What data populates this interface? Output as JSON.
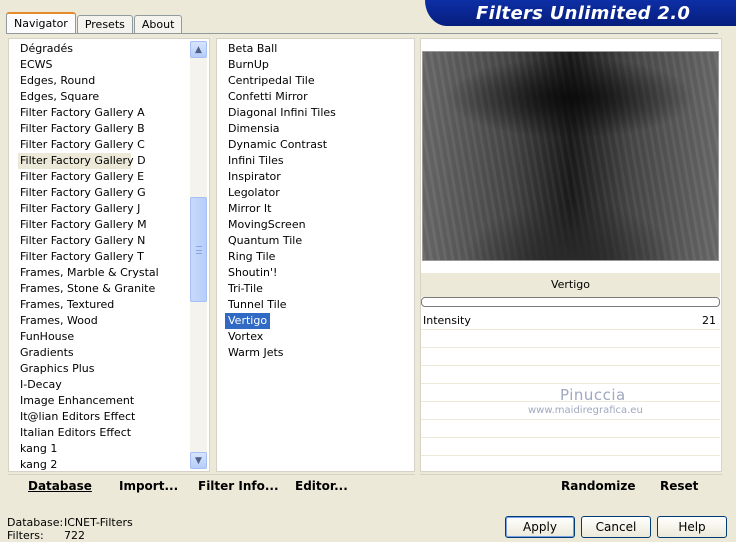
{
  "tabs": [
    "Navigator",
    "Presets",
    "About"
  ],
  "title": "Filters Unlimited 2.0",
  "categories": [
    "Dégradés",
    "ECWS",
    "Edges, Round",
    "Edges, Square",
    "Filter Factory Gallery A",
    "Filter Factory Gallery B",
    "Filter Factory Gallery C",
    "Filter Factory Gallery D",
    "Filter Factory Gallery E",
    "Filter Factory Gallery G",
    "Filter Factory Gallery J",
    "Filter Factory Gallery M",
    "Filter Factory Gallery N",
    "Filter Factory Gallery T",
    "Frames, Marble & Crystal",
    "Frames, Stone & Granite",
    "Frames, Textured",
    "Frames, Wood",
    "FunHouse",
    "Gradients",
    "Graphics Plus",
    "I-Decay",
    "Image Enhancement",
    "It@lian Editors Effect",
    "Italian Editors Effect",
    "kang 1",
    "kang 2"
  ],
  "selected_category": "Filter Factory Gallery D",
  "filters": [
    "Beta Ball",
    "BurnUp",
    "Centripedal Tile",
    "Confetti Mirror",
    "Diagonal Infini Tiles",
    "Dimensia",
    "Dynamic Contrast",
    "Infini Tiles",
    "Inspirator",
    "Legolator",
    "Mirror It",
    "MovingScreen",
    "Quantum Tile",
    "Ring Tile",
    "Shoutin'!",
    "Tri-Tile",
    "Tunnel Tile",
    "Vertigo",
    "Vortex",
    "Warm Jets"
  ],
  "selected_filter": "Vertigo",
  "filter_name": "Vertigo",
  "params": [
    {
      "label": "Intensity",
      "value": "21"
    }
  ],
  "watermark": {
    "line1": "Pinuccia",
    "line2": "www.maidiregrafica.eu"
  },
  "left_buttons": {
    "database": "Database",
    "import": "Import...",
    "filter_info": "Filter Info...",
    "editor": "Editor..."
  },
  "right_buttons": {
    "randomize": "Randomize",
    "reset": "Reset"
  },
  "status": {
    "database_label": "Database:",
    "database_value": "ICNET-Filters",
    "filters_label": "Filters:",
    "filters_value": "722"
  },
  "dialog": {
    "apply": "Apply",
    "cancel": "Cancel",
    "help": "Help"
  },
  "colors": {
    "banner": "#0d2fa6",
    "selection": "#316ac5"
  }
}
